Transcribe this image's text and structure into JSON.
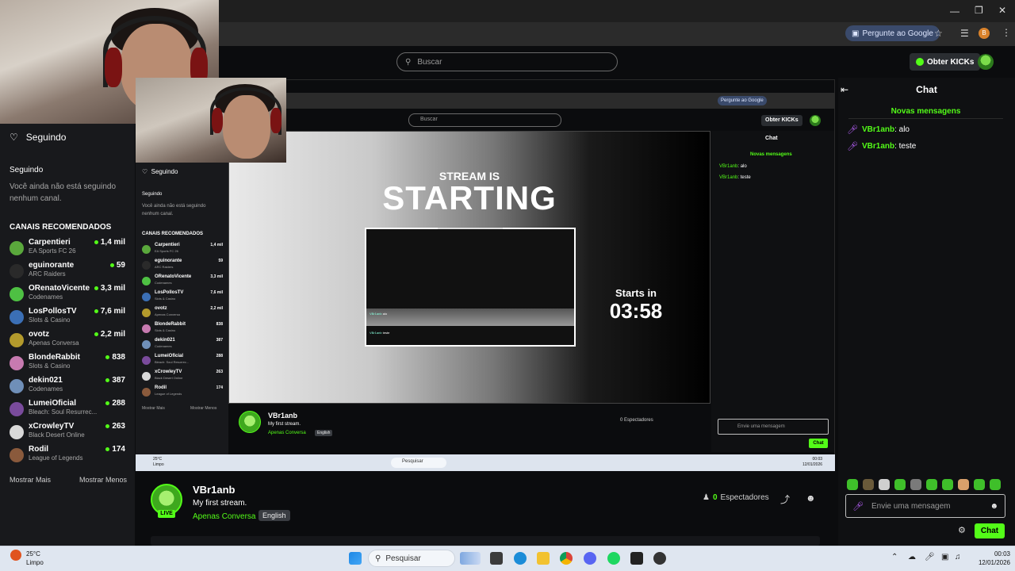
{
  "browser": {
    "google_pill": "Pergunte ao Google",
    "profile_initial": "B"
  },
  "header": {
    "search_placeholder": "Buscar",
    "kicks_button": "Obter KICKs"
  },
  "sidebar": {
    "following_header": "Seguindo",
    "following_section": "Seguindo",
    "following_empty": "Você ainda não está seguindo nenhum canal.",
    "recommended_title": "CANAIS RECOMENDADOS",
    "channels": [
      {
        "name": "Carpentieri",
        "category": "EA Sports FC 26",
        "viewers": "1,4 mil",
        "color": "#5aa83c"
      },
      {
        "name": "eguinorante",
        "category": "ARC Raiders",
        "viewers": "59",
        "color": "#2a2a2a"
      },
      {
        "name": "ORenatoVicente",
        "category": "Codenames",
        "viewers": "3,3 mil",
        "color": "#4ec043"
      },
      {
        "name": "LosPollosTV",
        "category": "Slots & Casino",
        "viewers": "7,6 mil",
        "color": "#3b6fb5"
      },
      {
        "name": "ovotz",
        "category": "Apenas Conversa",
        "viewers": "2,2 mil",
        "color": "#b39a2c"
      },
      {
        "name": "BlondeRabbit",
        "category": "Slots & Casino",
        "viewers": "838",
        "color": "#c77ab0"
      },
      {
        "name": "dekin021",
        "category": "Codenames",
        "viewers": "387",
        "color": "#6f8fb8"
      },
      {
        "name": "LumeiOficial",
        "category": "Bleach: Soul Resurrec...",
        "viewers": "288",
        "color": "#7a4b9c"
      },
      {
        "name": "xCrowleyTV",
        "category": "Black Desert Online",
        "viewers": "263",
        "color": "#d9d9d9"
      },
      {
        "name": "Rodil",
        "category": "League of Legends",
        "viewers": "174",
        "color": "#8a5a3c"
      }
    ],
    "show_more": "Mostrar Mais",
    "show_less": "Mostrar Menos"
  },
  "video": {
    "line1": "STREAM IS",
    "line2": "STARTING",
    "starts_in": "Starts in",
    "countdown": "03:58",
    "preview_msgs": [
      {
        "user": "VBr1anb",
        "text": "alo"
      },
      {
        "user": "VBr1anb",
        "text": "teste"
      }
    ]
  },
  "stream": {
    "live": "LIVE",
    "streamer": "VBr1anb",
    "title": "My first stream.",
    "category": "Apenas Conversa",
    "language": "English",
    "viewers_count": "0",
    "viewers_label": "Espectadores"
  },
  "chat": {
    "title": "Chat",
    "new_messages": "Novas mensagens",
    "messages": [
      {
        "user": "VBr1anb",
        "text": ": alo"
      },
      {
        "user": "VBr1anb",
        "text": ": teste"
      }
    ],
    "input_placeholder": "Envie uma mensagem",
    "send_button": "Chat",
    "emote_colors": [
      "#3fbf2a",
      "#6a5a3a",
      "#cfcfcf",
      "#3fbf2a",
      "#7a7a7a",
      "#3fbf2a",
      "#3fbf2a",
      "#d9a06b",
      "#3fbf2a",
      "#3fbf2a"
    ]
  },
  "nested": {
    "search": "Buscar",
    "kicks": "Obter KICKs",
    "google": "Pergunte ao Google",
    "chat_title": "Chat",
    "new_messages": "Novas mensagens",
    "msg1_user": "VBr1anb",
    "msg1_text": ": alo",
    "msg2_user": "VBr1anb",
    "msg2_text": ": teste",
    "input_placeholder": "Envie uma mensagem",
    "send": "Chat",
    "streamer": "VBr1anb",
    "title": "My first stream.",
    "category": "Apenas Conversa",
    "language": "English",
    "viewers": "0 Espectadores",
    "following": "Seguindo",
    "following_section": "Seguindo",
    "following_empty": "Você ainda não está seguindo nenhum canal.",
    "recommended": "CANAIS RECOMENDADOS",
    "show_more": "Mostrar Mais",
    "show_less": "Mostrar Menos",
    "taskbar_search": "Pesquisar",
    "weather_temp": "25°C",
    "weather_desc": "Limpo",
    "time": "00:03",
    "date": "12/01/2026"
  },
  "taskbar": {
    "weather_temp": "25°C",
    "weather_desc": "Limpo",
    "search": "Pesquisar",
    "time": "00:03",
    "date": "12/01/2026"
  }
}
